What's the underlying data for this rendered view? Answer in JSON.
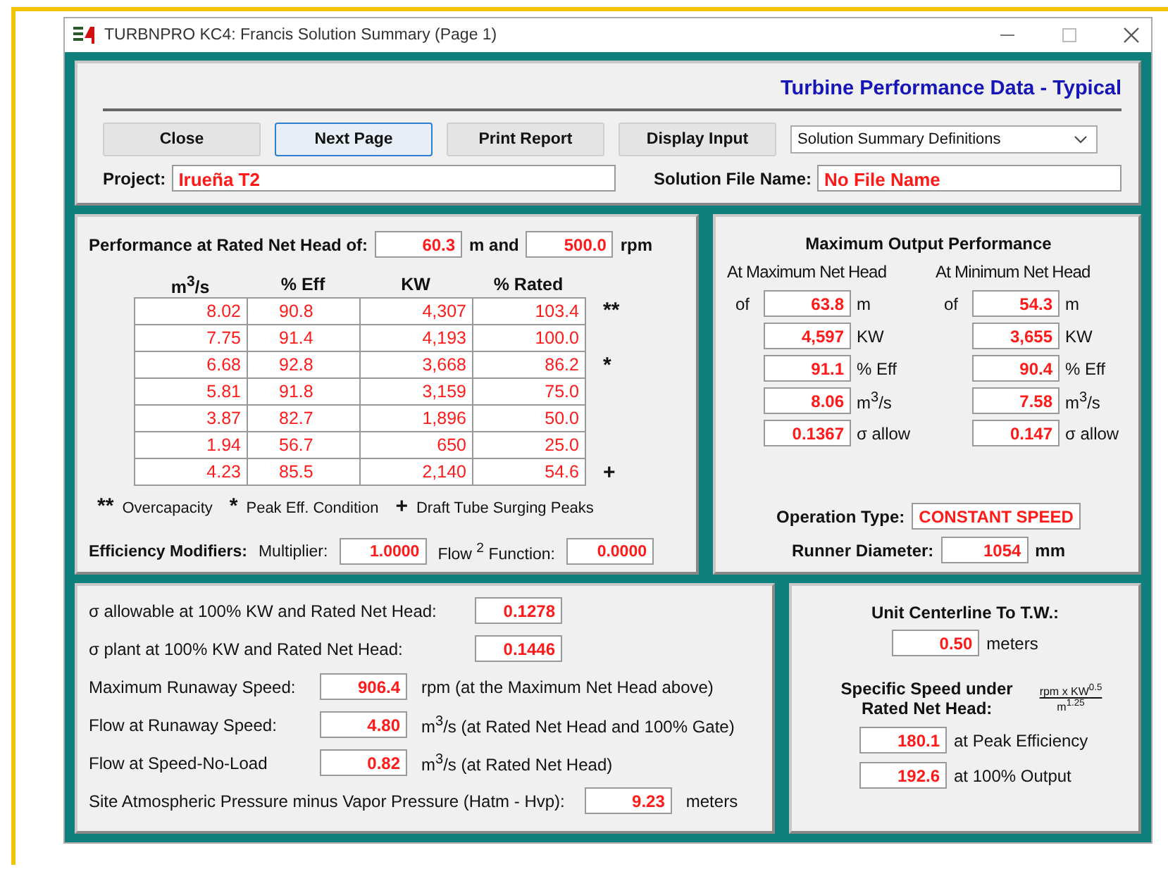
{
  "window": {
    "title": "TURBNPRO KC4:  Francis Solution Summary (Page 1)"
  },
  "header": {
    "title": "Turbine Performance Data - Typical",
    "buttons": [
      {
        "label": "Close",
        "focused": false
      },
      {
        "label": "Next Page",
        "focused": true
      },
      {
        "label": "Print Report",
        "focused": false
      },
      {
        "label": "Display Input",
        "focused": false
      }
    ],
    "dropdown": {
      "value": "Solution Summary Definitions"
    },
    "project": {
      "label": "Project:",
      "value": "Irueña T2"
    },
    "solution_file": {
      "label": "Solution File Name:",
      "value": "No File Name"
    }
  },
  "rated": {
    "label": "Performance at Rated Net Head of:",
    "head": "60.3",
    "head_unit": "m  and",
    "speed": "500.0",
    "speed_unit": "rpm",
    "columns": [
      "m$^{3}$/s",
      "% Eff",
      "KW",
      "% Rated"
    ],
    "rows": [
      {
        "cells": [
          "8.02",
          "90.8",
          "4,307",
          "103.4"
        ],
        "marker": "**"
      },
      {
        "cells": [
          "7.75",
          "91.4",
          "4,193",
          "100.0"
        ]
      },
      {
        "cells": [
          "6.68",
          "92.8",
          "3,668",
          "86.2"
        ],
        "marker": "*"
      },
      {
        "cells": [
          "5.81",
          "91.8",
          "3,159",
          "75.0"
        ]
      },
      {
        "cells": [
          "3.87",
          "82.7",
          "1,896",
          "50.0"
        ]
      },
      {
        "cells": [
          "1.94",
          "56.7",
          "650",
          "25.0"
        ]
      },
      {
        "cells": [
          "4.23",
          "85.5",
          "2,140",
          "54.6"
        ],
        "marker": "+"
      }
    ],
    "legend": [
      {
        "mark": "**",
        "text": "Overcapacity"
      },
      {
        "mark": "*",
        "text": "Peak Eff. Condition"
      },
      {
        "mark": "+",
        "text": "Draft Tube Surging Peaks"
      }
    ],
    "modifiers": {
      "label": "Efficiency Modifiers:",
      "multiplier_label": "Multiplier:",
      "multiplier": "1.0000",
      "flow_label": "Flow $^{2}$ Function:",
      "flow": "0.0000"
    }
  },
  "max_output": {
    "title": "Maximum Output Performance",
    "columns": [
      {
        "heading": "At Maximum Net Head",
        "of": "of",
        "values": [
          {
            "value": "63.8",
            "unit": "m"
          },
          {
            "value": "4,597",
            "unit": "KW"
          },
          {
            "value": "91.1",
            "unit": "% Eff"
          },
          {
            "value": "8.06",
            "unit": "m$^{3}$/s"
          },
          {
            "value": "0.1367",
            "unit": "σ allow"
          }
        ]
      },
      {
        "heading": "At Minimum Net Head",
        "of": "of",
        "values": [
          {
            "value": "54.3",
            "unit": "m"
          },
          {
            "value": "3,655",
            "unit": "KW"
          },
          {
            "value": "90.4",
            "unit": "% Eff"
          },
          {
            "value": "7.58",
            "unit": "m$^{3}$/s"
          },
          {
            "value": "0.147",
            "unit": "σ allow"
          }
        ]
      }
    ],
    "operation": {
      "label": "Operation Type:",
      "value": "CONSTANT SPEED"
    },
    "diameter": {
      "label": "Runner Diameter:",
      "value": "1054",
      "unit": "mm"
    }
  },
  "sigma": [
    {
      "label": "σ allowable at 100% KW and Rated Net Head:",
      "value": "0.1278"
    },
    {
      "label": "σ plant at 100% KW and Rated Net Head:",
      "value": "0.1446"
    }
  ],
  "runaway": [
    {
      "label": "Maximum Runaway Speed:",
      "value": "906.4",
      "note": "rpm (at the Maximum Net Head above)"
    },
    {
      "label": "Flow at Runaway Speed:",
      "value": "4.80",
      "note": "m$^{3}$/s (at Rated Net Head and 100% Gate)"
    },
    {
      "label": "Flow at Speed-No-Load",
      "value": "0.82",
      "note": "m$^{3}$/s (at Rated Net Head)"
    }
  ],
  "site": {
    "label": "Site Atmospheric Pressure minus Vapor Pressure (Hatm - Hvp):",
    "value": "9.23",
    "unit": "meters"
  },
  "centerline": {
    "label": "Unit Centerline To T.W.:",
    "value": "0.50",
    "unit": "meters"
  },
  "specific_speed": {
    "label": "Specific Speed under Rated Net Head:",
    "formula_top": "rpm x KW$^{0.5}$",
    "formula_bottom": "m$^{1.25}$",
    "values": [
      {
        "value": "180.1",
        "note": "at Peak Efficiency"
      },
      {
        "value": "192.6",
        "note": "at 100% Output"
      }
    ]
  }
}
